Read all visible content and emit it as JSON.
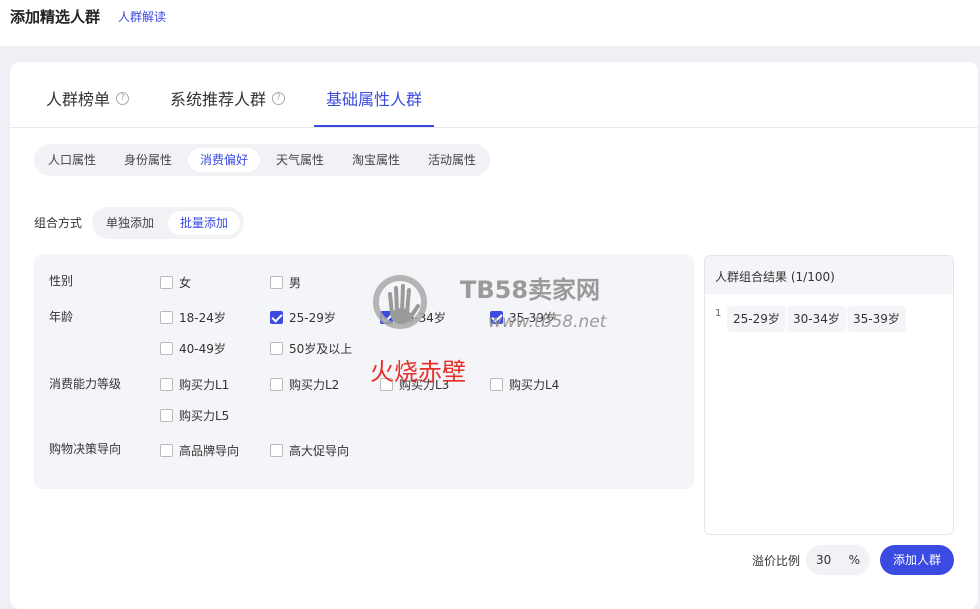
{
  "header": {
    "title": "添加精选人群",
    "help_link": "人群解读"
  },
  "main_tabs": [
    {
      "label": "人群榜单",
      "has_help": true
    },
    {
      "label": "系统推荐人群",
      "has_help": true
    },
    {
      "label": "基础属性人群",
      "active": true
    }
  ],
  "sub_tabs": [
    "人口属性",
    "身份属性",
    "消费偏好",
    "天气属性",
    "淘宝属性",
    "活动属性"
  ],
  "sub_tab_active": "消费偏好",
  "combine": {
    "label": "组合方式",
    "options": [
      "单独添加",
      "批量添加"
    ],
    "active": "批量添加"
  },
  "filters": {
    "gender": {
      "label": "性别",
      "options": [
        {
          "label": "女",
          "checked": false
        },
        {
          "label": "男",
          "checked": false
        }
      ]
    },
    "age": {
      "label": "年龄",
      "options": [
        {
          "label": "18-24岁",
          "checked": false
        },
        {
          "label": "25-29岁",
          "checked": true
        },
        {
          "label": "30-34岁",
          "checked": true
        },
        {
          "label": "35-39岁",
          "checked": true
        },
        {
          "label": "40-49岁",
          "checked": false
        },
        {
          "label": "50岁及以上",
          "checked": false
        }
      ]
    },
    "spending": {
      "label": "消费能力等级",
      "options": [
        {
          "label": "购买力L1",
          "checked": false
        },
        {
          "label": "购买力L2",
          "checked": false
        },
        {
          "label": "购买力L3",
          "checked": false
        },
        {
          "label": "购买力L4",
          "checked": false
        },
        {
          "label": "购买力L5",
          "checked": false
        }
      ]
    },
    "decision": {
      "label": "购物决策导向",
      "options": [
        {
          "label": "高品牌导向",
          "checked": false
        },
        {
          "label": "高大促导向",
          "checked": false
        }
      ]
    }
  },
  "result": {
    "title": "人群组合结果",
    "count": "(1/100)",
    "index": "1",
    "chips": [
      "25-29岁",
      "30-34岁",
      "35-39岁"
    ]
  },
  "ratio": {
    "label": "溢价比例",
    "value": "30",
    "unit": "%"
  },
  "add_button": "添加人群",
  "watermark": {
    "brand": "TB58卖家网",
    "url": "www.tb58.net",
    "overlay": "火烧赤壁"
  },
  "colors": {
    "accent": "#3b4ae0",
    "overlay_red": "#e8302a"
  }
}
